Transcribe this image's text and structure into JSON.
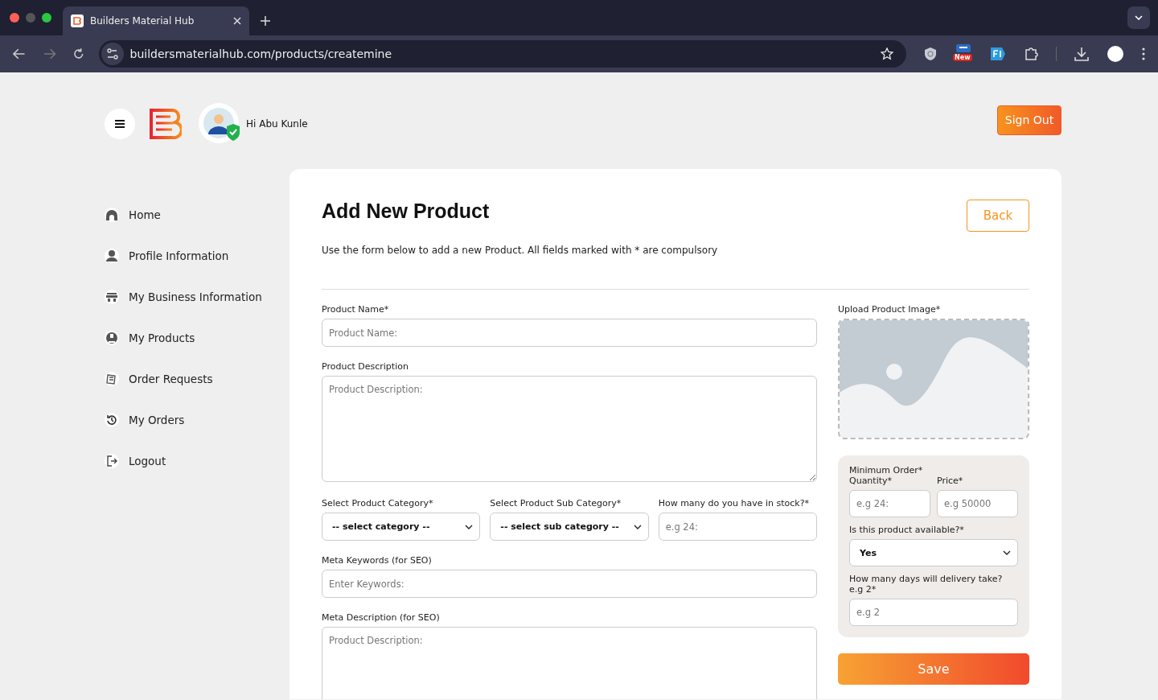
{
  "browser": {
    "tab_title": "Builders Material Hub",
    "url": "buildersmaterialhub.com/products/createmine",
    "extension_badge": "New"
  },
  "header": {
    "greeting": "Hi Abu Kunle",
    "sign_out": "Sign Out"
  },
  "sidebar": {
    "items": [
      {
        "label": "Home"
      },
      {
        "label": "Profile Information"
      },
      {
        "label": "My Business Information"
      },
      {
        "label": "My Products"
      },
      {
        "label": "Order Requests"
      },
      {
        "label": "My Orders"
      },
      {
        "label": "Logout"
      }
    ]
  },
  "form": {
    "title": "Add New Product",
    "back": "Back",
    "intro": "Use the form below to add a new Product. All fields marked with * are compulsory",
    "rows": [
      [
        {
          "kind": "input",
          "label": "Product Name*",
          "placeholder": "Product Name:"
        }
      ],
      [
        {
          "kind": "textarea",
          "label": "Product Description",
          "placeholder": "Product Description:"
        }
      ],
      [
        {
          "kind": "select",
          "label": "Select Product Category*",
          "value": "-- select category --"
        },
        {
          "kind": "select",
          "label": "Select Product Sub Category*",
          "value": "-- select sub category --"
        },
        {
          "kind": "input",
          "label": "How many do you have in stock?*",
          "placeholder": "e.g 24:"
        }
      ],
      [
        {
          "kind": "input",
          "label": "Meta Keywords (for SEO)",
          "placeholder": "Enter Keywords:"
        }
      ],
      [
        {
          "kind": "textarea",
          "label": "Meta Description (for SEO)",
          "placeholder": "Product Description:"
        }
      ]
    ],
    "image_label": "Upload Product Image*",
    "panel": [
      [
        {
          "kind": "input",
          "label": "Minimum Order* Quantity*",
          "placeholder": "e.g 24:"
        },
        {
          "kind": "input",
          "label": "Price*",
          "placeholder": "e.g 50000"
        }
      ],
      [
        {
          "kind": "select",
          "label": "Is this product available?*",
          "value": "Yes"
        }
      ],
      [
        {
          "kind": "input",
          "label": "How many days will delivery take? e.g 2*",
          "placeholder": "e.g 2"
        }
      ]
    ],
    "save": "Save"
  }
}
